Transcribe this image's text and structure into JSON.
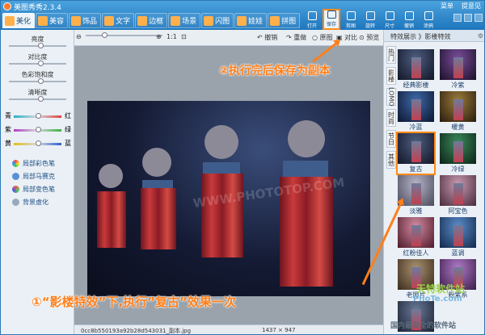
{
  "app": {
    "title": "美图秀秀2.3.4"
  },
  "tabs": [
    {
      "label": "美化",
      "active": true
    },
    {
      "label": "美容"
    },
    {
      "label": "饰品"
    },
    {
      "label": "文字"
    },
    {
      "label": "边框"
    },
    {
      "label": "场景"
    },
    {
      "label": "闪图"
    },
    {
      "label": "娃娃"
    },
    {
      "label": "拼图"
    }
  ],
  "toolbar": {
    "items": [
      "打开",
      "保存",
      "剪图",
      "旋转",
      "尺寸",
      "撤销",
      "涂鸦"
    ]
  },
  "window": {
    "menu": [
      "菜单",
      "提意见"
    ]
  },
  "left_panel": {
    "sliders": [
      "亮度",
      "对比度",
      "色彩饱和度",
      "清晰度"
    ],
    "color_sliders": [
      {
        "left": "青",
        "right": "红"
      },
      {
        "left": "紫",
        "right": "绿"
      },
      {
        "left": "黄",
        "right": "蓝"
      }
    ],
    "tools": [
      "局部彩色笔",
      "局部马赛克",
      "局部变色笔",
      "背景虚化"
    ]
  },
  "canvas_toolbar": {
    "zoom": "1:1",
    "undo": "撤销",
    "redo": "重做",
    "original": "原图",
    "compare": "对比",
    "preview": "预览"
  },
  "status": {
    "filename": "0cc8b550193a92b28d543031_副本.jpg",
    "size": "1437 × 947"
  },
  "right_panel": {
    "header": "特效展示 》影楼特效",
    "tabs": [
      "热门",
      "影楼",
      "LOMO",
      "时尚",
      "节日",
      "其他"
    ],
    "effects": [
      {
        "label": "经典影楼"
      },
      {
        "label": "冷紫"
      },
      {
        "label": "冷蓝"
      },
      {
        "label": "暖黄"
      },
      {
        "label": "复古",
        "selected": true
      },
      {
        "label": "冷绿"
      },
      {
        "label": "淡雅"
      },
      {
        "label": "阿宝色"
      },
      {
        "label": "红粉佳人"
      },
      {
        "label": "蓝调"
      },
      {
        "label": "老照片"
      },
      {
        "label": "粉紫系"
      },
      {
        "label": ""
      }
    ]
  },
  "annotations": {
    "step1": "①“影楼特效”下,执行”复古”效果一次",
    "step2": "②执行完后保存为副本"
  },
  "watermark": "WWW.PHOTOTOP.COM",
  "brand": {
    "name": "天特软件站",
    "url": "PhoTe.com",
    "slogan": "国内最安全的软件站"
  },
  "colors": {
    "accent": "#ff7f1a",
    "titlebar": "#1e76bd"
  }
}
